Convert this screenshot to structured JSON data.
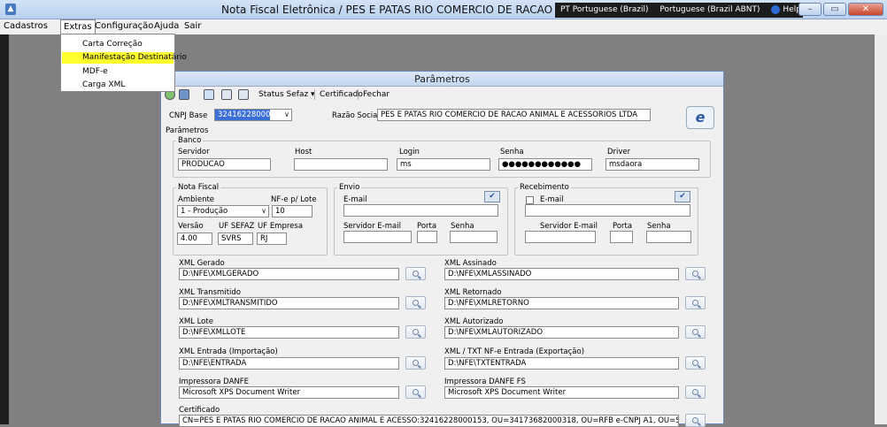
{
  "titlebar": {
    "title": "Nota Fiscal Eletrônica / PES E PATAS RIO COMERCIO DE RACAO ANIMAL E ACESSÓ",
    "lang1": "PT Portuguese (Brazil)",
    "lang2": "Portuguese (Brazil ABNT)",
    "help": "Help"
  },
  "menu": {
    "cadastros": "Cadastros",
    "extras": "Extras",
    "configuracao": "Configuração",
    "ajuda": "Ajuda",
    "sair": "Sair"
  },
  "dropdown": {
    "items": [
      "Carta Correção",
      "Manifestação Destinatário",
      "MDF-e",
      "Carga XML"
    ]
  },
  "window": {
    "title": "Parâmetros",
    "toolbar": {
      "status": "Status Sefaz ▾",
      "certificado": "Certificado",
      "fechar": "Fechar"
    },
    "cnpj_label": "CNPJ Base",
    "cnpj_value": "32416228000153",
    "razao_label": "Razão Social",
    "razao_value": "PES E PATAS RIO COMERCIO DE RACAO ANIMAL E ACESSORIOS LTDA",
    "parametros_label": "Parâmetros",
    "banco": {
      "label": "Banco",
      "servidor_label": "Servidor",
      "servidor_value": "PRODUCAO",
      "host_label": "Host",
      "host_value": "",
      "login_label": "Login",
      "login_value": "ms",
      "senha_label": "Senha",
      "senha_value": "●●●●●●●●●●●●",
      "driver_label": "Driver",
      "driver_value": "msdaora"
    },
    "nota": {
      "label": "Nota Fiscal",
      "ambiente_label": "Ambiente",
      "ambiente_value": "1 - Produção",
      "nfe_lote_label": "NF-e p/ Lote",
      "nfe_lote_value": "10",
      "versao_label": "Versão",
      "versao_value": "4.00",
      "uf_sefaz_label": "UF SEFAZ",
      "uf_sefaz_value": "SVRS",
      "uf_empresa_label": "UF Empresa",
      "uf_empresa_value": "RJ"
    },
    "envio": {
      "label": "Envio",
      "email_label": "E-mail",
      "servidor_email_label": "Servidor E-mail",
      "porta_label": "Porta",
      "senha_label": "Senha"
    },
    "recebimento": {
      "label": "Recebimento",
      "email_label": "E-mail",
      "servidor_email_label": "Servidor E-mail",
      "porta_label": "Porta",
      "senha_label": "Senha"
    },
    "paths": {
      "xml_gerado_label": "XML Gerado",
      "xml_gerado": "D:\\NFE\\XMLGERADO",
      "xml_assinado_label": "XML Assinado",
      "xml_assinado": "D:\\NFE\\XMLASSINADO",
      "xml_transmitido_label": "XML Transmitido",
      "xml_transmitido": "D:\\NFE\\XMLTRANSMITIDO",
      "xml_retornado_label": "XML Retornado",
      "xml_retornado": "D:\\NFE\\XMLRETORNO",
      "xml_lote_label": "XML Lote",
      "xml_lote": "D:\\NFE\\XMLLOTE",
      "xml_autorizado_label": "XML Autorizado",
      "xml_autorizado": "D:\\NFE\\XMLAUTORIZADO",
      "xml_entrada_label": "XML Entrada (Importação)",
      "xml_entrada": "D:\\NFE\\ENTRADA",
      "xml_txt_label": "XML / TXT NF-e Entrada (Exportação)",
      "xml_txt": "D:\\NFE\\TXTENTRADA",
      "danfe_label": "Impressora DANFE",
      "danfe": "Microsoft XPS Document Writer",
      "danfe_fs_label": "Impressora DANFE FS",
      "danfe_fs": "Microsoft XPS Document Writer",
      "certificado_label": "Certificado",
      "certificado": "CN=PES E PATAS RIO COMERCIO DE RACAO ANIMAL E ACESSO:32416228000153, OU=34173682000318, OU=RFB e-CNPJ A1, OU=Secretaria da Receita Fed"
    }
  }
}
